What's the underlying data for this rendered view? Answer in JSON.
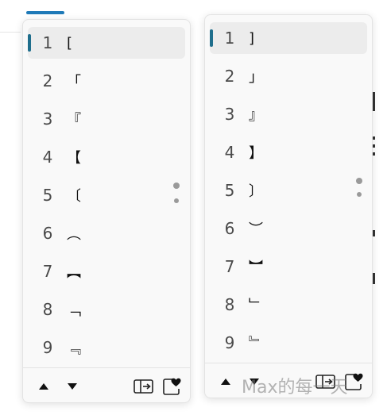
{
  "left_panel": {
    "items": [
      {
        "num": "1",
        "glyph": "["
      },
      {
        "num": "2",
        "glyph": "「"
      },
      {
        "num": "3",
        "glyph": "『"
      },
      {
        "num": "4",
        "glyph": "【"
      },
      {
        "num": "5",
        "glyph": "〔"
      },
      {
        "num": "6",
        "glyph": "︵"
      },
      {
        "num": "7",
        "glyph": "︻"
      },
      {
        "num": "8",
        "glyph": "﹁"
      },
      {
        "num": "9",
        "glyph": "﹃"
      }
    ],
    "selected_index": 0
  },
  "right_panel": {
    "items": [
      {
        "num": "1",
        "glyph": "]"
      },
      {
        "num": "2",
        "glyph": "」"
      },
      {
        "num": "3",
        "glyph": "』"
      },
      {
        "num": "4",
        "glyph": "】"
      },
      {
        "num": "5",
        "glyph": "〕"
      },
      {
        "num": "6",
        "glyph": "︶"
      },
      {
        "num": "7",
        "glyph": "︼"
      },
      {
        "num": "8",
        "glyph": "﹂"
      },
      {
        "num": "9",
        "glyph": "﹄"
      }
    ],
    "selected_index": 0
  },
  "toolbar": {
    "icons": [
      "triangle-up-icon",
      "triangle-down-icon",
      "expand-panel-icon",
      "favorite-heart-icon"
    ]
  },
  "watermark": "Max的每一天",
  "colors": {
    "selection_indicator": "#1f6e8c",
    "panel_bg": "#f9f9f9",
    "selected_row_bg": "#ececec"
  }
}
